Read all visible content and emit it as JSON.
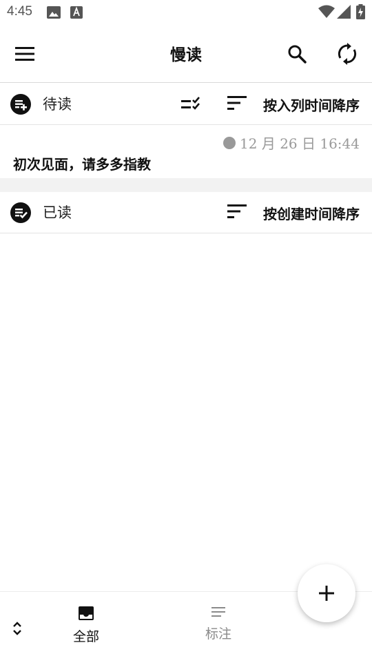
{
  "status_bar": {
    "time": "4:45",
    "icons": [
      "image-icon",
      "font-icon",
      "wifi-icon",
      "signal-icon",
      "battery-charging-icon"
    ]
  },
  "app_bar": {
    "title": "慢读",
    "icons": [
      "menu-icon",
      "search-icon",
      "sync-icon"
    ]
  },
  "sections": {
    "unread": {
      "label": "待读",
      "icon": "playlist-add-icon",
      "sort_label": "按入列时间降序"
    },
    "read": {
      "label": "已读",
      "icon": "playlist-check-icon",
      "sort_label": "按创建时间降序"
    }
  },
  "articles": [
    {
      "date": "12 月 26 日 16:44",
      "title": "初次见面，请多多指教"
    }
  ],
  "bottom_nav": {
    "tabs": [
      {
        "label": "全部",
        "icon": "inbox-icon",
        "active": true
      },
      {
        "label": "标注",
        "icon": "notes-icon",
        "active": false
      }
    ]
  },
  "colors": {
    "primary_text": "#111111",
    "secondary_text": "#999999",
    "divider": "#e3e3e3",
    "band": "#f2f2f2",
    "inactive": "#8a8a8a"
  }
}
